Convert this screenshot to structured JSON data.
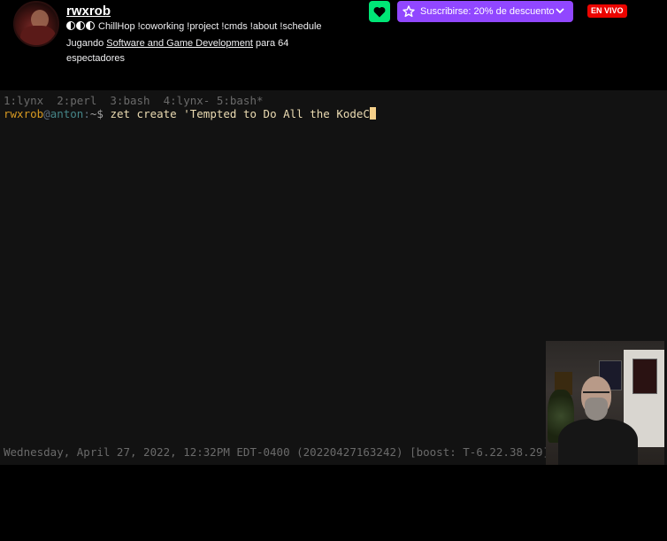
{
  "channel": {
    "name": "rwxrob",
    "title": "ChillHop !coworking !project !cmds !about !schedule",
    "playing_prefix": "Jugando",
    "category": "Software and Game Development",
    "viewers_text": "para 64 espectadores"
  },
  "actions": {
    "follow_icon": "heart-icon",
    "subscribe_label": "Suscribirse: 20% de descuento",
    "live_badge": "EN VIVO"
  },
  "terminal": {
    "tmux_tabs": "1:lynx  2:perl  3:bash  4:lynx- 5:bash*",
    "prompt_user": "rwxrob",
    "prompt_at": "@",
    "prompt_host": "anton",
    "prompt_sep": ":",
    "prompt_path": "~$",
    "command": " zet create 'Tempted to Do All the KodeC",
    "status_line": "Wednesday, April 27, 2022, 12:32PM EDT-0400 (20220427163242) [boost: T-6.22.38.29]"
  },
  "colors": {
    "follow_green": "#00e676",
    "subscribe_purple": "#9147ff",
    "live_red": "#eb0400"
  }
}
